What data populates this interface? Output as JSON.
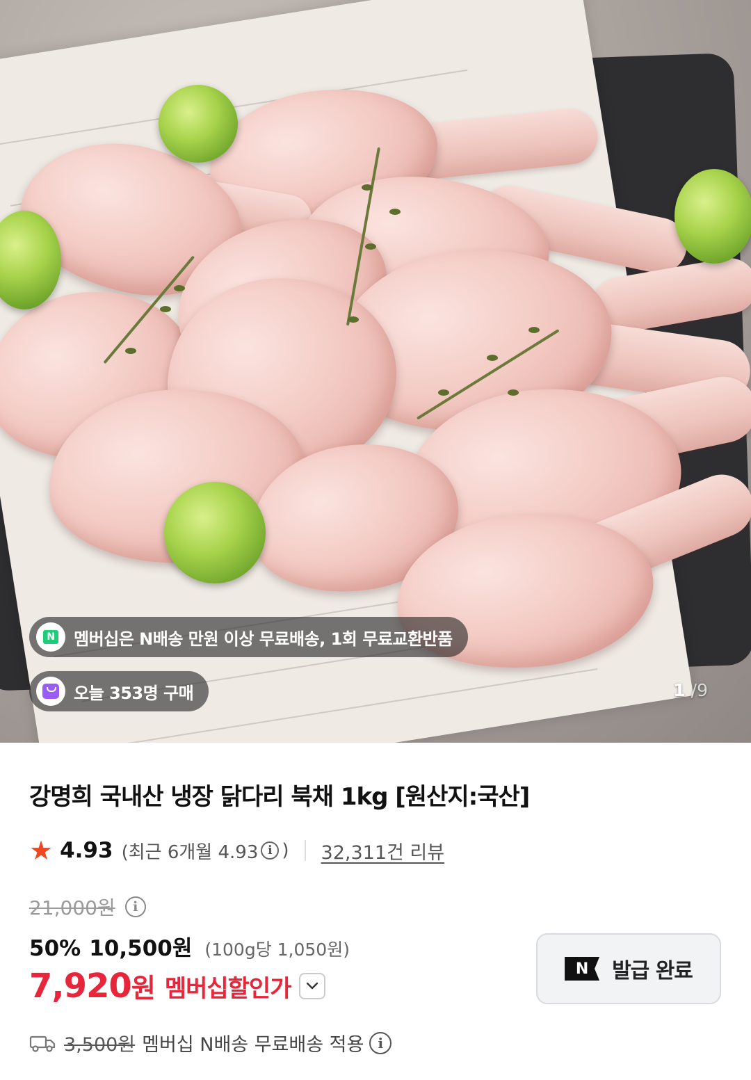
{
  "image": {
    "counter_current": "1",
    "counter_separator": "/",
    "counter_total": "9",
    "membership_banner": "멤버십은 N배송 만원 이상 무료배송, 1회 무료교환반품",
    "membership_icon": "N",
    "purchase_banner": "오늘 353명 구매"
  },
  "product": {
    "title": "강명희 국내산 냉장 닭다리 북채 1kg [원산지:국산]",
    "rating": "4.93",
    "recent_rating_prefix": "(최근 6개월 4.93",
    "recent_rating_suffix": ")",
    "review_count": "32,311건 리뷰"
  },
  "price": {
    "original": "21,000원",
    "discount_percent": "50%",
    "sale_price": "10,500원",
    "unit_price": "(100g당 1,050원)",
    "member_price_value": "7,920",
    "member_price_unit": "원",
    "member_label": "멤버십할인가"
  },
  "coupon": {
    "logo": "N",
    "label": "발급 완료"
  },
  "shipping": {
    "original_fee": "3,500원",
    "label": "멤버십 N배송 무료배송 적용"
  },
  "colors": {
    "accent_red": "#e8263b",
    "star": "#f0471f",
    "n_green": "#1fcc7a",
    "bag_purple": "#9b5cf5"
  },
  "icons": [
    "star-icon",
    "info-icon",
    "chevron-down-icon",
    "truck-icon",
    "naver-n-icon",
    "shopping-bag-icon"
  ]
}
